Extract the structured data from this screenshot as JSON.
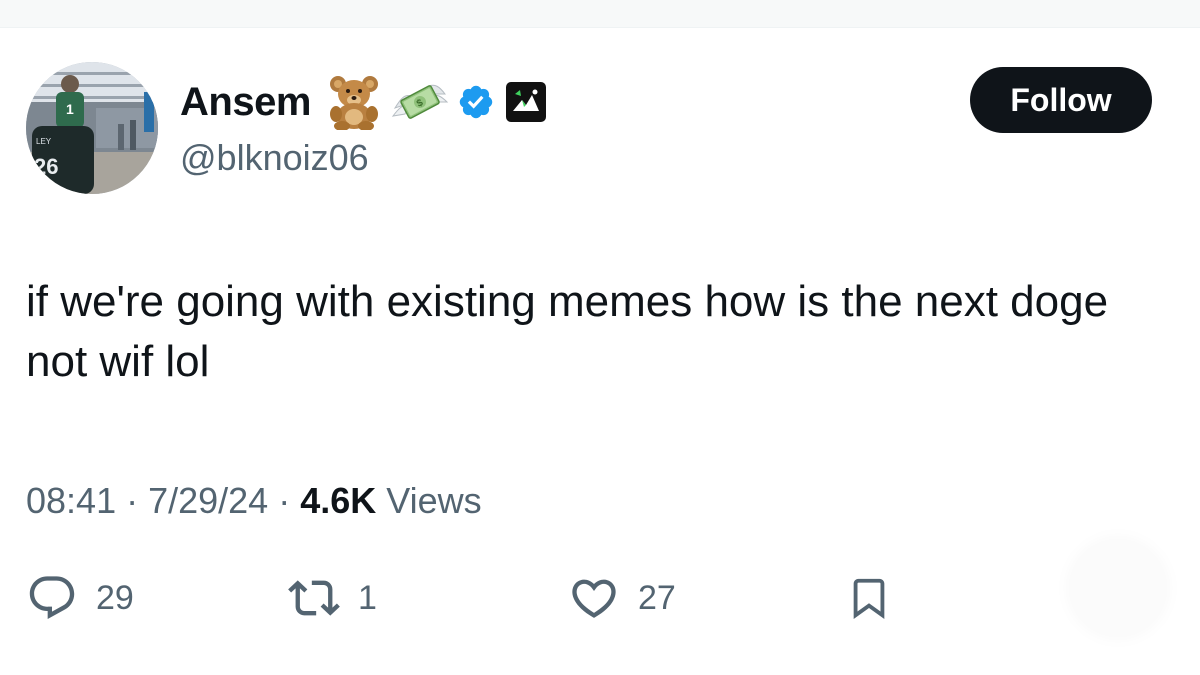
{
  "colors": {
    "text_primary": "#0f1419",
    "text_secondary": "#536471",
    "verified_blue": "#1d9bf0",
    "follow_bg": "#0f1419",
    "follow_text": "#ffffff"
  },
  "author": {
    "name": "Ansem",
    "handle": "@blknoiz06",
    "avatar_icon": "avatar-photo",
    "name_badges": [
      "teddy-bear-emoji",
      "money-with-wings-emoji",
      "verified-badge-icon",
      "brand-affiliate-badge-icon"
    ]
  },
  "follow_button": {
    "label": "Follow"
  },
  "tweet": {
    "text": "if we're going with existing memes how is the next doge not wif lol"
  },
  "meta": {
    "time": "08:41",
    "separator_1": " · ",
    "date": "7/29/24",
    "separator_2": " · ",
    "views_count": "4.6K",
    "views_label": " Views"
  },
  "actions": {
    "reply": {
      "icon": "reply-icon",
      "count": "29"
    },
    "retweet": {
      "icon": "retweet-icon",
      "count": "1"
    },
    "like": {
      "icon": "heart-icon",
      "count": "27"
    },
    "bookmark": {
      "icon": "bookmark-icon"
    }
  }
}
